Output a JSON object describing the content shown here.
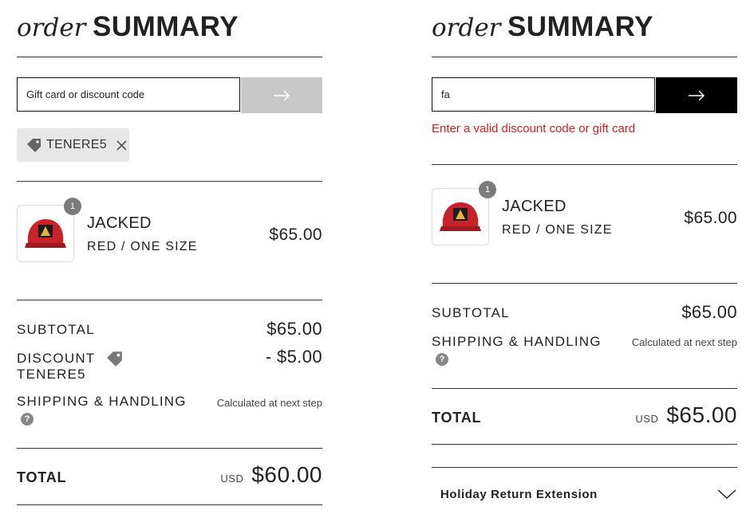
{
  "left": {
    "title_italic": "order",
    "title_bold": "SUMMARY",
    "discount_placeholder": "Gift card or discount code",
    "applied_code": "TENERE5",
    "product": {
      "name": "JACKED",
      "variant": "RED / ONE SIZE",
      "price": "$65.00",
      "quantity": "1"
    },
    "subtotal": {
      "label": "SUBTOTAL",
      "value": "$65.00"
    },
    "discount": {
      "label": "DISCOUNT",
      "code": "TENERE5",
      "value": "- $5.00"
    },
    "shipping": {
      "label": "SHIPPING & HANDLING",
      "value": "Calculated at next step",
      "help": "?"
    },
    "total": {
      "label": "TOTAL",
      "currency": "USD",
      "value": "$60.00"
    }
  },
  "right": {
    "title_italic": "order",
    "title_bold": "SUMMARY",
    "discount_value": "fa",
    "error": "Enter a valid discount code or gift card",
    "product": {
      "name": "JACKED",
      "variant": "RED / ONE SIZE",
      "price": "$65.00",
      "quantity": "1"
    },
    "subtotal": {
      "label": "SUBTOTAL",
      "value": "$65.00"
    },
    "shipping": {
      "label": "SHIPPING & HANDLING",
      "value": "Calculated at next step",
      "help": "?"
    },
    "total": {
      "label": "TOTAL",
      "currency": "USD",
      "value": "$65.00"
    },
    "accordion": {
      "label": "Holiday Return Extension"
    }
  },
  "icons": {
    "apply": "arrow-right-icon",
    "tag": "tag-icon",
    "remove": "close-icon",
    "help": "question-icon",
    "expand": "chevron-down-icon",
    "product": "cap-icon"
  },
  "colors": {
    "error": "#d21f1f",
    "apply_disabled": "#c8c8c8",
    "apply_enabled": "#000000",
    "chip_bg": "#e7e7e7"
  }
}
